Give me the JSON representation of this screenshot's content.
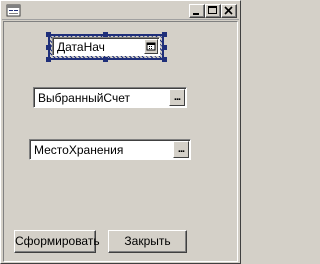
{
  "fields": {
    "date_start": {
      "value": "ДатаНач",
      "button_icon": "calendar-icon"
    },
    "selected_account": {
      "value": "ВыбранныйСчет",
      "button_label": "..."
    },
    "storage_location": {
      "value": "МестоХранения",
      "button_label": "..."
    }
  },
  "buttons": {
    "generate_label": "Сформировать",
    "close_label": "Закрыть"
  },
  "titlebar": {
    "icon": "form-window-icon",
    "controls": [
      "minimize-icon",
      "maximize-icon",
      "close-icon"
    ]
  },
  "colors": {
    "face": "#d4d0c8",
    "selection": "#1f2f7a"
  }
}
